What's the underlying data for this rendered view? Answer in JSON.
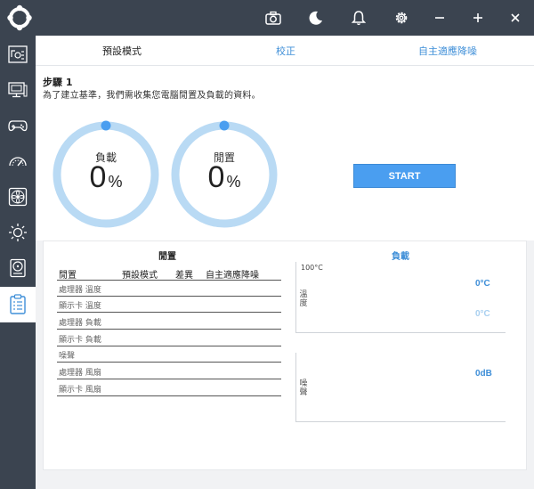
{
  "titlebar": {
    "buttons": [
      "camera-icon",
      "moon-icon",
      "bell-icon",
      "gear-icon",
      "minimize-icon",
      "maximize-icon",
      "close-icon"
    ]
  },
  "sidebar": {
    "items": [
      "dashboard-icon",
      "monitor-icon",
      "gamepad-icon",
      "speedometer-icon",
      "fan-icon",
      "brightness-icon",
      "hard-drive-icon",
      "checklist-icon"
    ],
    "active_index": 7
  },
  "tabs": {
    "preset": "預設模式",
    "calibrate": "校正",
    "auto_noise": "自主適應降噪"
  },
  "step": {
    "title": "步驟 1",
    "description": "為了建立基準，我們需收集您電腦閒置及負載的資料。"
  },
  "gauges": {
    "load": {
      "label": "負載",
      "value": "0",
      "unit": "%"
    },
    "idle": {
      "label": "閒置",
      "value": "0",
      "unit": "%"
    }
  },
  "start_label": "START",
  "idle_panel": {
    "title": "閒置",
    "headers": [
      "閒置",
      "預設模式",
      "差異",
      "自主適應降噪"
    ],
    "rows": [
      "處理器 溫度",
      "顯示卡 溫度",
      "處理器 負載",
      "顯示卡 負載",
      "噪聲",
      "處理器 風扇",
      "顯示卡 風扇"
    ]
  },
  "load_panel": {
    "title": "負載",
    "temp_axis_top": "100°C",
    "temp_axis_label": "溫度",
    "temp_reading_1": "0°C",
    "temp_reading_2": "0°C",
    "noise_axis_label": "噪聲",
    "noise_reading": "0dB"
  },
  "colors": {
    "accent": "#4a9ef0",
    "ring": "#b9daf4",
    "ring_dot": "#4a9ef0",
    "chrome": "#3b4450"
  }
}
